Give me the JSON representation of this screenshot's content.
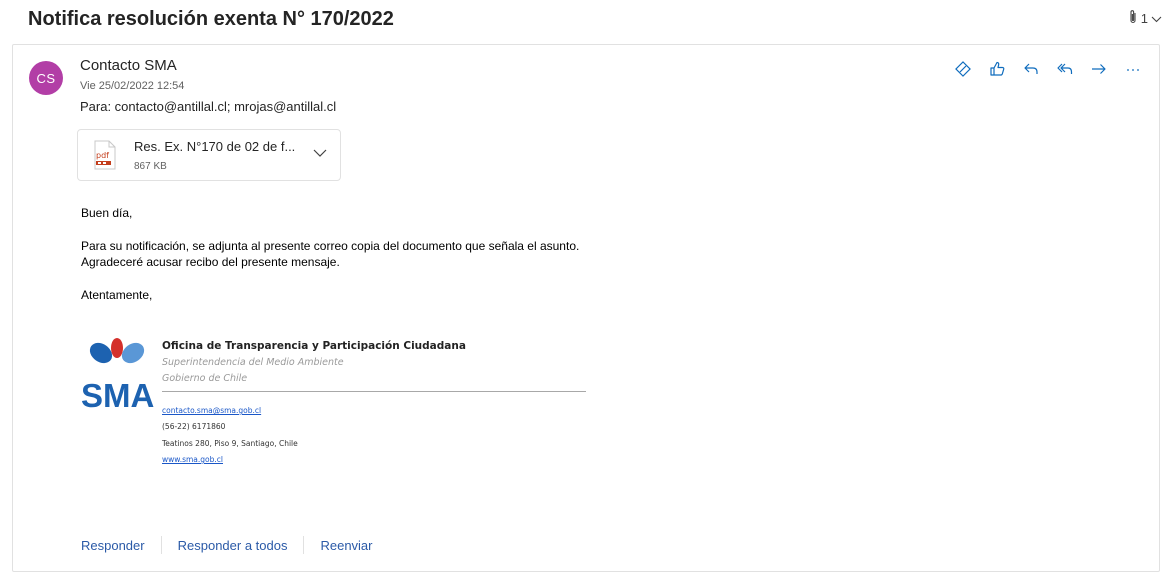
{
  "subject": "Notifica resolución exenta N° 170/2022",
  "attachment_count": "1",
  "message": {
    "avatar_initials": "CS",
    "sender": "Contacto SMA",
    "date": "Vie 25/02/2022 12:54",
    "to": "Para:  contacto@antillal.cl; mrojas@antillal.cl",
    "attachment": {
      "name": "Res. Ex. N°170 de 02 de f...",
      "size": "867 KB",
      "type_label": "pdf"
    },
    "body": {
      "greeting": "Buen día,",
      "line1": "Para su notificación, se adjunta al presente correo copia del documento que señala el asunto.",
      "line2": "Agradeceré acusar recibo del presente mensaje.",
      "closing": "Atentamente,"
    },
    "signature": {
      "logo_text": "SMA",
      "title": "Oficina de Transparencia y Participación Ciudadana",
      "subtitle1": "Superintendencia del Medio Ambiente",
      "subtitle2": "Gobierno de Chile",
      "email": "contacto.sma@sma.gob.cl",
      "phone": "(56-22) 6171860",
      "address": "Teatinos 280, Piso 9, Santiago, Chile",
      "website": "www.sma.gob.cl"
    }
  },
  "reply_bar": {
    "reply": "Responder",
    "reply_all": "Responder a todos",
    "forward": "Reenviar"
  },
  "colors": {
    "accent": "#0f6cbd",
    "avatar": "#b23ea6",
    "link": "#2b5aa7",
    "sma_blue": "#1d62b0",
    "sma_red": "#d4302b"
  }
}
